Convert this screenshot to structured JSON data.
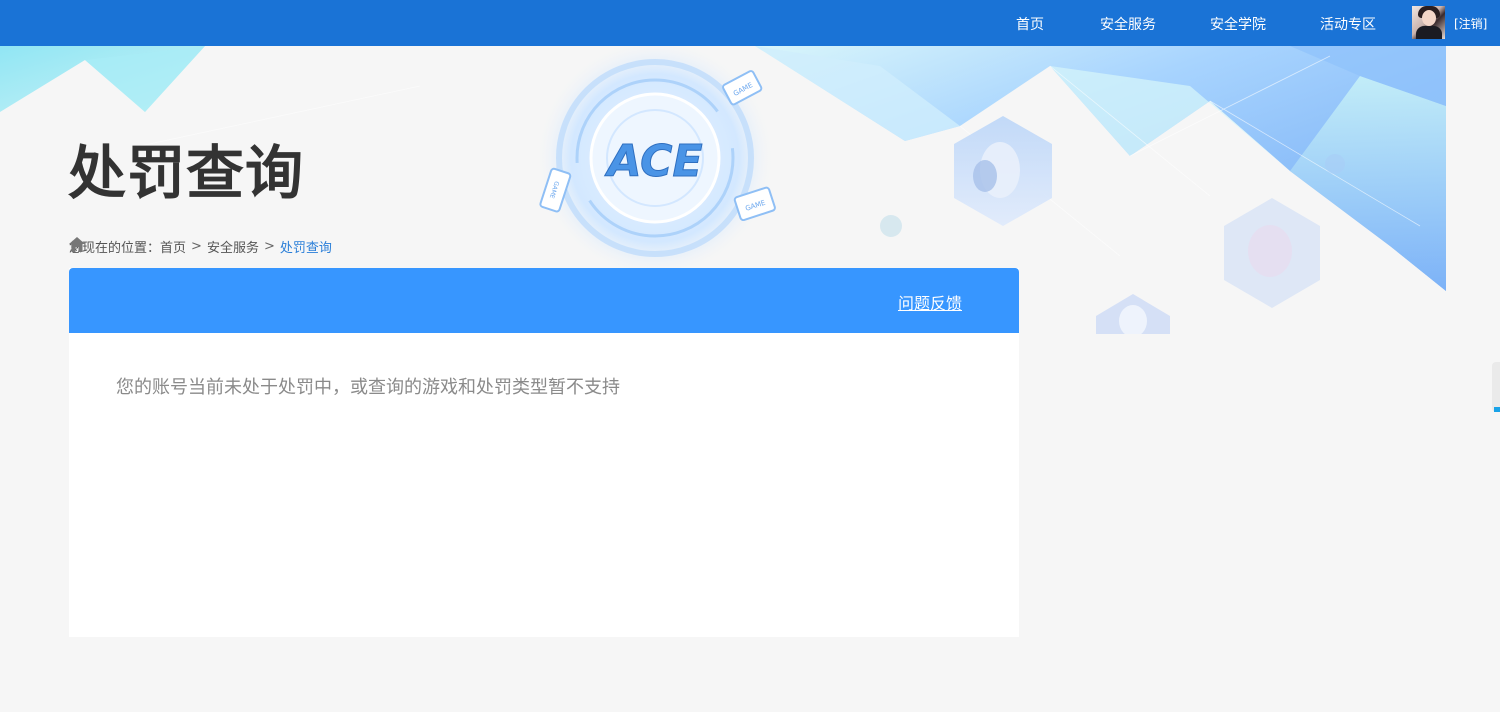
{
  "nav": {
    "items": [
      {
        "label": "首页"
      },
      {
        "label": "安全服务"
      },
      {
        "label": "安全学院"
      },
      {
        "label": "活动专区"
      }
    ],
    "logout_label": "[注销]"
  },
  "banner": {
    "logo_text": "ACE",
    "device_text": "GAME"
  },
  "page": {
    "title": "处罚查询"
  },
  "breadcrumb": {
    "prefix": "您现在的位置：",
    "items": [
      {
        "label": "首页"
      },
      {
        "label": "安全服务"
      },
      {
        "label": "处罚查询"
      }
    ],
    "separator": ">"
  },
  "panel": {
    "feedback_label": "问题反馈",
    "message": "您的账号当前未处于处罚中，或查询的游戏和处罚类型暂不支持"
  },
  "colors": {
    "topbar": "#1a73d6",
    "panel_header": "#3796ff",
    "title": "#333333",
    "breadcrumb_current": "#2b7fd8",
    "message": "#8a8a8a",
    "background": "#f6f6f6"
  },
  "icons": {
    "breadcrumb_home": "home-icon"
  }
}
